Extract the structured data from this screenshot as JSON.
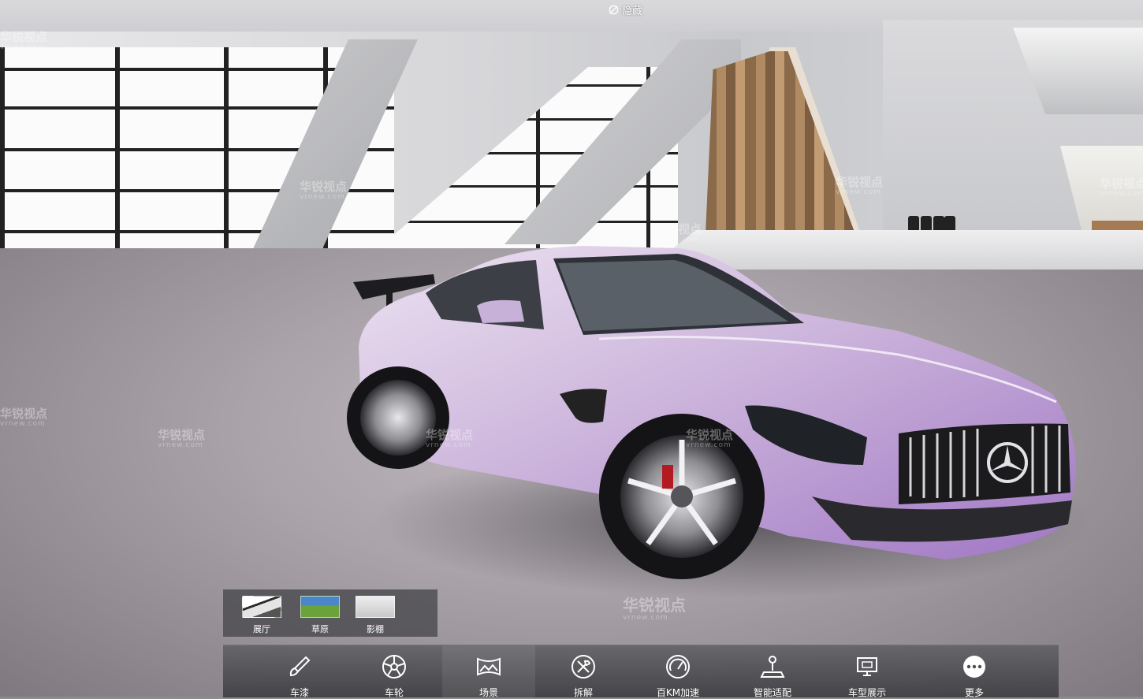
{
  "top_toggle": {
    "label": "隐藏",
    "icon": "eye-off-icon"
  },
  "scene_picker": {
    "items": [
      {
        "label": "展厅",
        "icon": "showroom-thumbnail"
      },
      {
        "label": "草原",
        "icon": "grassland-thumbnail"
      },
      {
        "label": "影棚",
        "icon": "studio-thumbnail"
      }
    ]
  },
  "toolbar": {
    "items": [
      {
        "label": "车漆",
        "icon": "paint-brush-icon"
      },
      {
        "label": "车轮",
        "icon": "wheel-icon"
      },
      {
        "label": "场景",
        "icon": "scene-icon"
      },
      {
        "label": "拆解",
        "icon": "tools-icon"
      },
      {
        "label": "百KM加速",
        "icon": "speedometer-icon"
      },
      {
        "label": "智能适配",
        "icon": "joystick-icon"
      },
      {
        "label": "车型展示",
        "icon": "display-icon"
      },
      {
        "label": "更多",
        "icon": "more-icon"
      }
    ]
  },
  "watermark": {
    "brand": "华锐视点",
    "url": "vrnew.com"
  },
  "colors": {
    "car_paint": "#c7aed6",
    "toolbar_bg": "#4e4e52"
  }
}
